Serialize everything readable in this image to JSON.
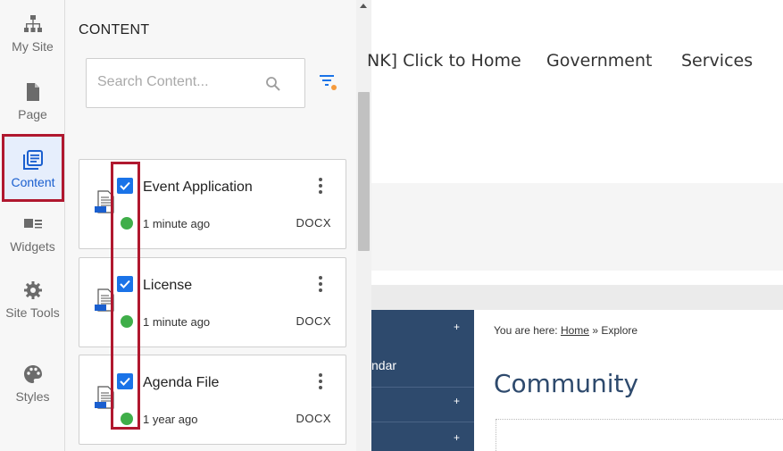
{
  "rail": {
    "items": [
      {
        "label": "My Site",
        "icon": "sitemap-icon"
      },
      {
        "label": "Page",
        "icon": "page-icon"
      },
      {
        "label": "Content",
        "icon": "content-icon",
        "active": true
      },
      {
        "label": "Widgets",
        "icon": "widgets-icon"
      },
      {
        "label": "Site Tools",
        "icon": "gear-icon"
      },
      {
        "label": "Styles",
        "icon": "palette-icon"
      }
    ]
  },
  "panel": {
    "title": "CONTENT",
    "search_placeholder": "Search Content...",
    "items": [
      {
        "title": "Event Application",
        "time": "1 minute ago",
        "type": "DOCX",
        "checked": true
      },
      {
        "title": "License",
        "time": "1 minute ago",
        "type": "DOCX",
        "checked": true
      },
      {
        "title": "Agenda File",
        "time": "1 year ago",
        "type": "DOCX",
        "checked": true
      }
    ]
  },
  "site": {
    "nav": [
      "NK] Click to Home",
      "Government",
      "Services"
    ],
    "menu_text": "ndar",
    "breadcrumb": {
      "prefix": "You are here:",
      "home": "Home",
      "sep": "»",
      "current": "Explore"
    },
    "heading": "Community"
  },
  "colors": {
    "accent": "#1a73e8",
    "highlight": "#b0182f",
    "status": "#3fae49",
    "menu_bg": "#2e4a6d"
  }
}
